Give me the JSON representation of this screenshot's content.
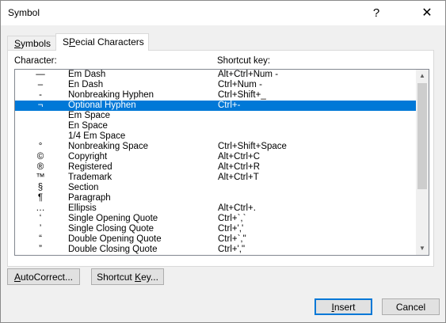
{
  "window": {
    "title": "Symbol",
    "help_glyph": "?",
    "close_glyph": "✕"
  },
  "tabs": [
    {
      "label": "Symbols",
      "mnemonic": "S",
      "rest": "ymbols",
      "active": false
    },
    {
      "label": "Special Characters",
      "mnemonic": "P",
      "pre": "S",
      "rest": "ecial Characters",
      "active": true
    }
  ],
  "list": {
    "col_character": "Character:",
    "col_shortcut": "Shortcut key:",
    "items": [
      {
        "char": "—",
        "name": "Em Dash",
        "shortcut": "Alt+Ctrl+Num -"
      },
      {
        "char": "–",
        "name": "En Dash",
        "shortcut": "Ctrl+Num -"
      },
      {
        "char": "-",
        "name": "Nonbreaking Hyphen",
        "shortcut": "Ctrl+Shift+_"
      },
      {
        "char": "¬",
        "name": "Optional Hyphen",
        "shortcut": "Ctrl+-",
        "selected": true
      },
      {
        "char": "",
        "name": "Em Space",
        "shortcut": ""
      },
      {
        "char": "",
        "name": "En Space",
        "shortcut": ""
      },
      {
        "char": "",
        "name": "1/4 Em Space",
        "shortcut": ""
      },
      {
        "char": "°",
        "name": "Nonbreaking Space",
        "shortcut": "Ctrl+Shift+Space"
      },
      {
        "char": "©",
        "name": "Copyright",
        "shortcut": "Alt+Ctrl+C"
      },
      {
        "char": "®",
        "name": "Registered",
        "shortcut": "Alt+Ctrl+R"
      },
      {
        "char": "™",
        "name": "Trademark",
        "shortcut": "Alt+Ctrl+T"
      },
      {
        "char": "§",
        "name": "Section",
        "shortcut": ""
      },
      {
        "char": "¶",
        "name": "Paragraph",
        "shortcut": ""
      },
      {
        "char": "…",
        "name": "Ellipsis",
        "shortcut": "Alt+Ctrl+."
      },
      {
        "char": "‘",
        "name": "Single Opening Quote",
        "shortcut": "Ctrl+`,`"
      },
      {
        "char": "’",
        "name": "Single Closing Quote",
        "shortcut": "Ctrl+','"
      },
      {
        "char": "“",
        "name": "Double Opening Quote",
        "shortcut": "Ctrl+`,\""
      },
      {
        "char": "”",
        "name": "Double Closing Quote",
        "shortcut": "Ctrl+',\""
      }
    ]
  },
  "buttons": {
    "autocorrect": {
      "label": "AutoCorrect...",
      "mnemonic": "A",
      "rest": "utoCorrect..."
    },
    "shortcut_key": {
      "label": "Shortcut Key...",
      "pre": "Shortcut ",
      "mnemonic": "K",
      "rest": "ey..."
    },
    "insert": {
      "label": "Insert",
      "mnemonic": "I",
      "rest": "nsert"
    },
    "cancel": {
      "label": "Cancel"
    }
  },
  "colors": {
    "selection": "#0078d7",
    "dialog_bg": "#f0f0f0"
  }
}
